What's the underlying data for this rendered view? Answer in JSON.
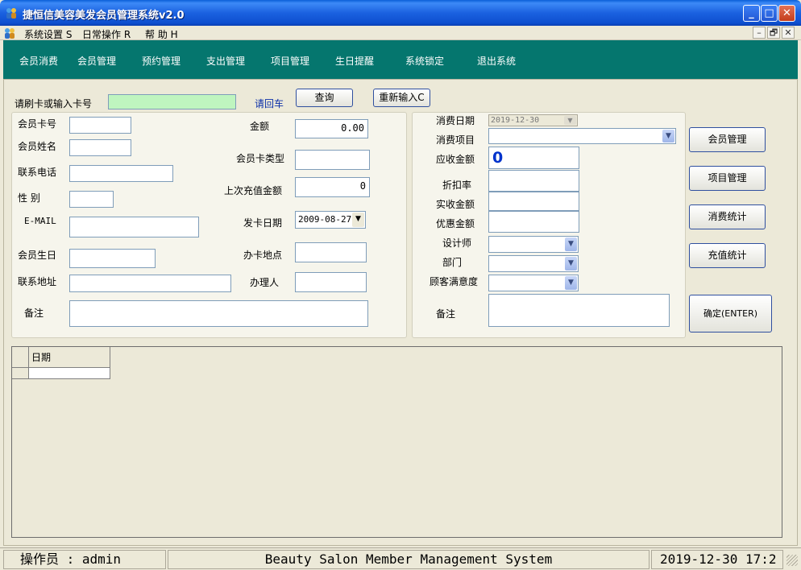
{
  "window": {
    "title": "捷恒信美容美发会员管理系统v2.0",
    "buttons": {
      "minimize": "_",
      "maximize": "□",
      "close": "✕"
    }
  },
  "menubar": {
    "items": [
      "系统设置 S",
      "日常操作 R",
      "帮  助 H"
    ],
    "mdi_buttons": [
      "–",
      "🗗",
      "✕"
    ]
  },
  "toolbar": {
    "items": [
      "会员消费",
      "会员管理",
      "预约管理",
      "支出管理",
      "项目管理",
      "生日提醒",
      "系统锁定",
      "退出系统"
    ]
  },
  "card_search": {
    "label": "请刷卡或输入卡号",
    "value": "",
    "hint": "请回车",
    "query_button": "查询",
    "reset_button": "重新输入C"
  },
  "member": {
    "card_no_label": "会员卡号",
    "name_label": "会员姓名",
    "phone_label": "联系电话",
    "gender_label": "性  别",
    "email_label": "E-MAIL",
    "birthday_label": "会员生日",
    "address_label": "联系地址",
    "note_label": "备注",
    "amount_label": "金额",
    "amount_value": "0.00",
    "card_type_label": "会员卡类型",
    "last_recharge_label": "上次充值金额",
    "last_recharge_value": "0",
    "issue_date_label": "发卡日期",
    "issue_date_value": "2009-08-27",
    "location_label": "办卡地点",
    "handler_label": "办理人"
  },
  "consume": {
    "date_label": "消费日期",
    "date_value": "2019-12-30",
    "item_label": "消费项目",
    "receivable_label": "应收金额",
    "receivable_value": "0",
    "discount_label": "折扣率",
    "actual_label": "实收金额",
    "promo_label": "优惠金额",
    "designer_label": "设计师",
    "dept_label": "部门",
    "satisfaction_label": "顾客满意度",
    "note_label": "备注"
  },
  "side_buttons": {
    "member_mgmt": "会员管理",
    "item_mgmt": "项目管理",
    "consume_stats": "消费统计",
    "recharge_stats": "充值统计",
    "confirm": "确定(ENTER)"
  },
  "grid": {
    "columns": [
      "日期"
    ]
  },
  "statusbar": {
    "operator": "操作员 : admin",
    "system_name": "Beauty Salon Member Management System",
    "datetime": "2019-12-30 17:2"
  }
}
